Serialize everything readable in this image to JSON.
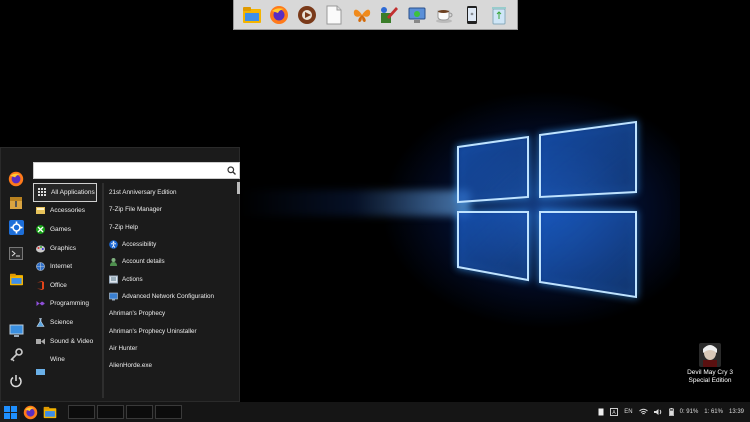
{
  "desktop": {
    "icon_label_line1": "Devil May Cry 3",
    "icon_label_line2": "Special Edition"
  },
  "dock": {
    "items": [
      "file-manager-icon",
      "firefox-icon",
      "media-player-icon",
      "text-document-icon",
      "butterfly-icon",
      "paint-icon",
      "remote-desktop-icon",
      "coffee-icon",
      "phone-icon",
      "recycle-bin-icon"
    ]
  },
  "start_menu": {
    "search": {
      "value": "",
      "placeholder": ""
    },
    "categories": [
      {
        "label": "All Applications",
        "icon": "grid-icon",
        "active": true
      },
      {
        "label": "Accessories",
        "icon": "accessories-icon"
      },
      {
        "label": "Games",
        "icon": "games-icon"
      },
      {
        "label": "Graphics",
        "icon": "graphics-icon"
      },
      {
        "label": "Internet",
        "icon": "internet-icon"
      },
      {
        "label": "Office",
        "icon": "office-icon"
      },
      {
        "label": "Programming",
        "icon": "programming-icon"
      },
      {
        "label": "Science",
        "icon": "science-icon"
      },
      {
        "label": "Sound & Video",
        "icon": "sound-video-icon"
      },
      {
        "label": "Wine",
        "icon": ""
      }
    ],
    "apps": [
      {
        "label": "21st Anniversary Edition",
        "icon": ""
      },
      {
        "label": "7-Zip File Manager",
        "icon": ""
      },
      {
        "label": "7-Zip Help",
        "icon": ""
      },
      {
        "label": "Accessibility",
        "icon": "accessibility-icon"
      },
      {
        "label": "Account details",
        "icon": "account-icon"
      },
      {
        "label": "Actions",
        "icon": "actions-icon"
      },
      {
        "label": "Advanced Network Configuration",
        "icon": "network-icon"
      },
      {
        "label": "Ahriman's Prophecy",
        "icon": ""
      },
      {
        "label": "Ahriman's Prophecy Uninstaller",
        "icon": ""
      },
      {
        "label": "Air Hunter",
        "icon": ""
      },
      {
        "label": "AlienHorde.exe",
        "icon": ""
      }
    ],
    "rail": [
      "firefox-icon",
      "archive-icon",
      "settings-icon",
      "terminal-icon",
      "file-manager-icon",
      "display-icon",
      "key-icon",
      "power-icon"
    ]
  },
  "taskbar": {
    "tray": {
      "language": "EN",
      "battery_text": "0: 91%",
      "battery2_text": "1: 61%",
      "clock": "13:39"
    }
  },
  "colors": {
    "accent": "#1e8fff",
    "menu_bg": "#1b1b1b",
    "taskbar_bg": "#151515"
  }
}
